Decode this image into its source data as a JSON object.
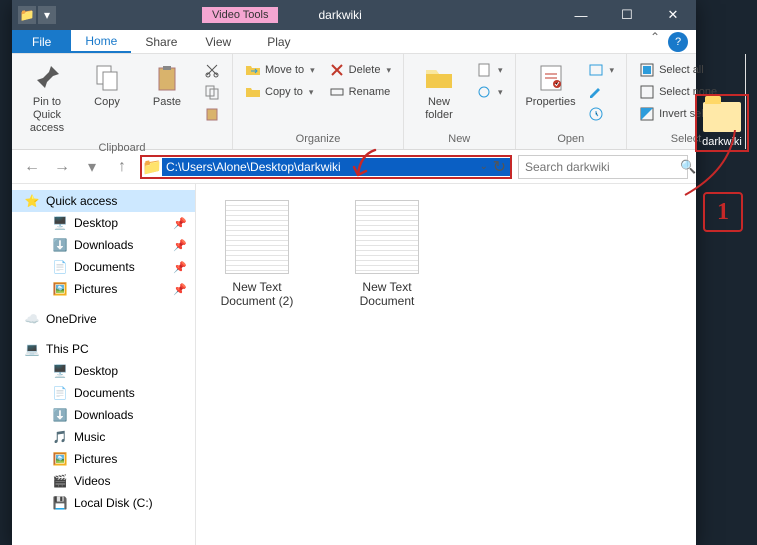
{
  "titlebar": {
    "tools_label": "Video Tools",
    "title": "darkwiki",
    "min": "—",
    "max": "☐",
    "close": "✕"
  },
  "tabs": {
    "file": "File",
    "home": "Home",
    "share": "Share",
    "view": "View",
    "play": "Play"
  },
  "ribbon": {
    "clipboard": {
      "label": "Clipboard",
      "pin": "Pin to Quick access",
      "copy": "Copy",
      "paste": "Paste"
    },
    "organize": {
      "label": "Organize",
      "moveto": "Move to",
      "copyto": "Copy to",
      "delete": "Delete",
      "rename": "Rename"
    },
    "new": {
      "label": "New",
      "newfolder": "New folder"
    },
    "open": {
      "label": "Open",
      "properties": "Properties"
    },
    "select": {
      "label": "Select",
      "all": "Select all",
      "none": "Select none",
      "invert": "Invert selection"
    }
  },
  "address": {
    "path": "C:\\Users\\Alone\\Desktop\\darkwiki",
    "search_placeholder": "Search darkwiki"
  },
  "sidebar": {
    "quickaccess": "Quick access",
    "desktop": "Desktop",
    "downloads": "Downloads",
    "documents": "Documents",
    "pictures": "Pictures",
    "onedrive": "OneDrive",
    "thispc": "This PC",
    "pc_desktop": "Desktop",
    "pc_documents": "Documents",
    "pc_downloads": "Downloads",
    "pc_music": "Music",
    "pc_pictures": "Pictures",
    "pc_videos": "Videos",
    "pc_localdisk": "Local Disk (C:)"
  },
  "files": {
    "item1": "New Text Document (2)",
    "item2": "New Text Document"
  },
  "desktop_icon": {
    "label": "darkwiki"
  },
  "annotations": {
    "number1": "1"
  }
}
